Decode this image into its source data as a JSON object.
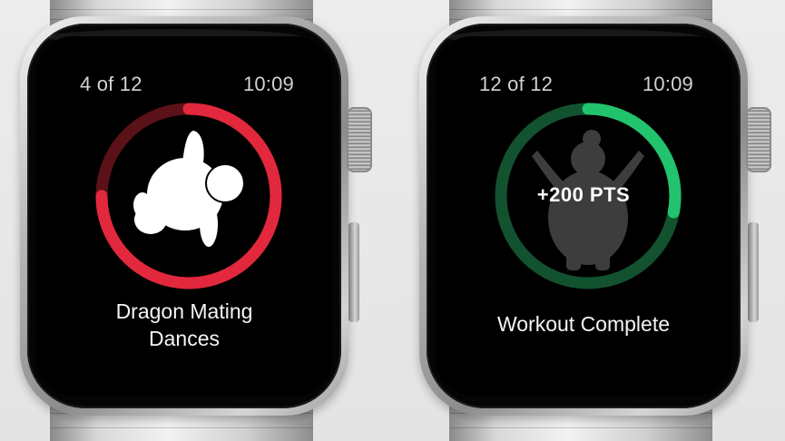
{
  "watches": [
    {
      "progress_label": "4 of 12",
      "time": "10:09",
      "exercise_line1": "Dragon Mating",
      "exercise_line2": "Dances",
      "ring_color": "#e2283d",
      "ring_track_color": "#5a1118",
      "ring_fraction": 0.75,
      "icon": "exercise-figure-icon"
    },
    {
      "progress_label": "12 of 12",
      "time": "10:09",
      "points": "+200 PTS",
      "status_text": "Workout Complete",
      "ring_color": "#22c36d",
      "ring_track_color": "#12522f",
      "ring_fraction": 0.28,
      "icon": "celebrating-figure-icon"
    }
  ]
}
